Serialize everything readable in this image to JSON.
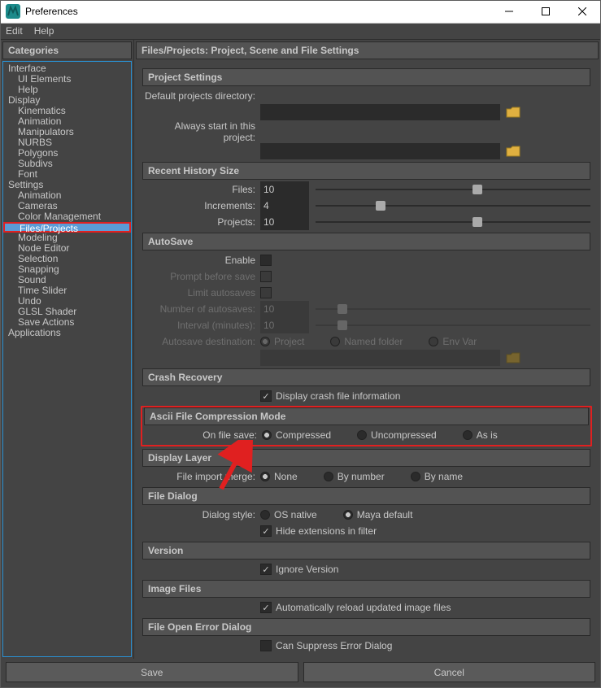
{
  "window": {
    "title": "Preferences"
  },
  "menu": {
    "edit": "Edit",
    "help": "Help"
  },
  "categories": {
    "title": "Categories",
    "items": [
      {
        "label": "Interface",
        "lvl": 0
      },
      {
        "label": "UI Elements",
        "lvl": 1
      },
      {
        "label": "Help",
        "lvl": 1
      },
      {
        "label": "Display",
        "lvl": 0
      },
      {
        "label": "Kinematics",
        "lvl": 1
      },
      {
        "label": "Animation",
        "lvl": 1
      },
      {
        "label": "Manipulators",
        "lvl": 1
      },
      {
        "label": "NURBS",
        "lvl": 1
      },
      {
        "label": "Polygons",
        "lvl": 1
      },
      {
        "label": "Subdivs",
        "lvl": 1
      },
      {
        "label": "Font",
        "lvl": 1
      },
      {
        "label": "Settings",
        "lvl": 0
      },
      {
        "label": "Animation",
        "lvl": 1
      },
      {
        "label": "Cameras",
        "lvl": 1
      },
      {
        "label": "Color Management",
        "lvl": 1
      },
      {
        "label": "Files/Projects",
        "lvl": 1,
        "sel": true
      },
      {
        "label": "Modeling",
        "lvl": 1
      },
      {
        "label": "Node Editor",
        "lvl": 1
      },
      {
        "label": "Selection",
        "lvl": 1
      },
      {
        "label": "Snapping",
        "lvl": 1
      },
      {
        "label": "Sound",
        "lvl": 1
      },
      {
        "label": "Time Slider",
        "lvl": 1
      },
      {
        "label": "Undo",
        "lvl": 1
      },
      {
        "label": "GLSL Shader",
        "lvl": 1
      },
      {
        "label": "Save Actions",
        "lvl": 1
      },
      {
        "label": "Applications",
        "lvl": 0
      }
    ]
  },
  "content": {
    "title": "Files/Projects: Project, Scene and File Settings",
    "project_settings": {
      "header": "Project Settings",
      "default_dir_label": "Default projects directory:",
      "always_start_label": "Always start in this project:"
    },
    "recent_history": {
      "header": "Recent History Size",
      "files_label": "Files:",
      "files_value": "10",
      "increments_label": "Increments:",
      "increments_value": "4",
      "projects_label": "Projects:",
      "projects_value": "10"
    },
    "autosave": {
      "header": "AutoSave",
      "enable_label": "Enable",
      "prompt_label": "Prompt before save",
      "limit_label": "Limit autosaves",
      "number_label": "Number of autosaves:",
      "number_value": "10",
      "interval_label": "Interval (minutes):",
      "interval_value": "10",
      "dest_label": "Autosave destination:",
      "dest_project": "Project",
      "dest_named": "Named folder",
      "dest_env": "Env Var"
    },
    "crash": {
      "header": "Crash Recovery",
      "display_info": "Display crash file information"
    },
    "ascii": {
      "header": "Ascii File Compression Mode",
      "on_save_label": "On file save:",
      "compressed": "Compressed",
      "uncompressed": "Uncompressed",
      "asis": "As is"
    },
    "display_layer": {
      "header": "Display Layer",
      "merge_label": "File import merge:",
      "none": "None",
      "by_number": "By number",
      "by_name": "By name"
    },
    "file_dialog": {
      "header": "File Dialog",
      "style_label": "Dialog style:",
      "os_native": "OS native",
      "maya_default": "Maya default",
      "hide_ext": "Hide extensions in filter"
    },
    "version": {
      "header": "Version",
      "ignore": "Ignore Version"
    },
    "image_files": {
      "header": "Image Files",
      "reload": "Automatically reload updated image files"
    },
    "file_open_err": {
      "header": "File Open Error Dialog",
      "suppress": "Can Suppress Error Dialog"
    }
  },
  "footer": {
    "save": "Save",
    "cancel": "Cancel"
  }
}
